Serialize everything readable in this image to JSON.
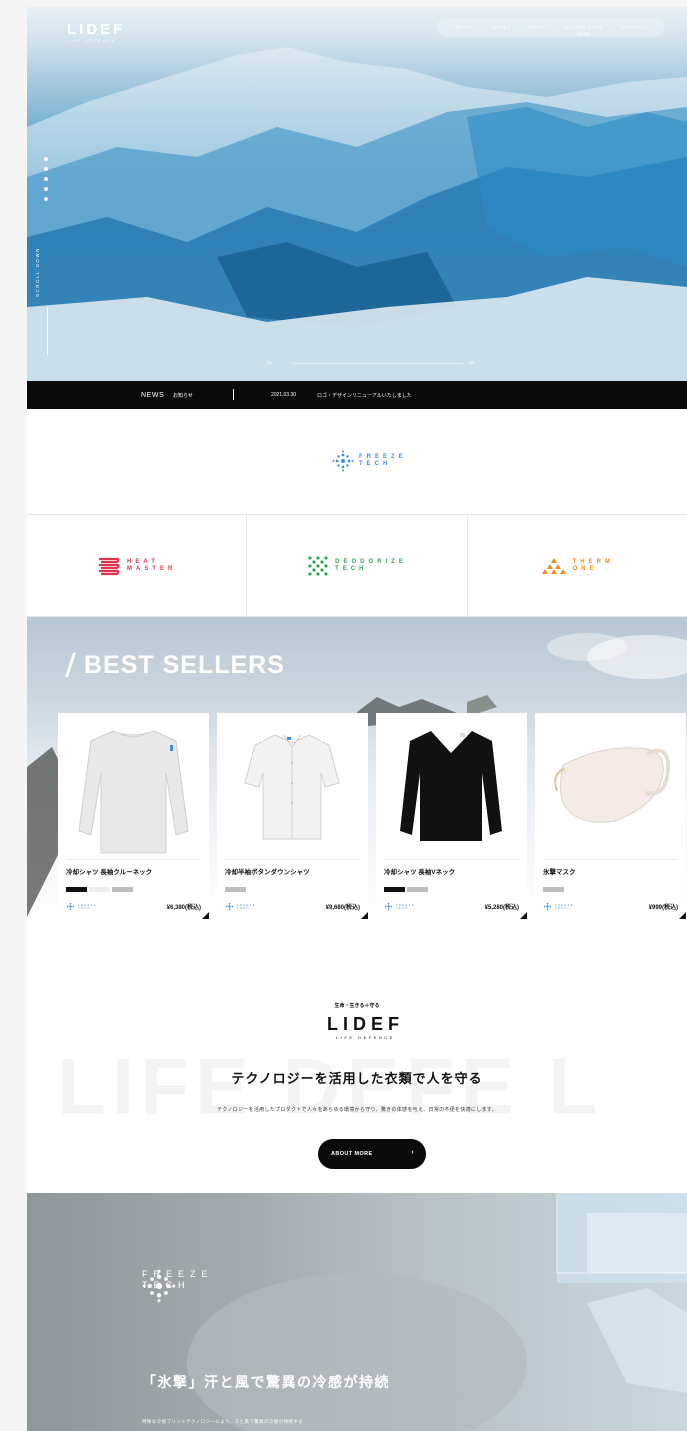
{
  "header": {
    "logo": "LIDEF",
    "logo_sub": "LIFE DEFENCE",
    "nav": [
      "ABOUT",
      "SERIES",
      "NEWS",
      "ONLINE SHOP",
      "CONTACT"
    ],
    "nav_shop_sub": "楽天市場"
  },
  "hero": {
    "scroll_label": "SCROLL DOWN",
    "slide_current": "01",
    "slide_total": "04"
  },
  "news": {
    "label": "NEWS",
    "label_jp": "お知らせ",
    "date": "2021.03.30",
    "text": "ロゴ・デザインリニューアルいたしました"
  },
  "brands": {
    "freeze": [
      "FREEZE",
      "TECH"
    ],
    "heat": [
      "HEAT",
      "MASTER"
    ],
    "deodorize": [
      "DEODORIZE",
      "TECH"
    ],
    "therm": [
      "THERM",
      "ONE"
    ],
    "colors": {
      "freeze": "#3c8fd4",
      "heat": "#e0344e",
      "deodorize": "#2ea55a",
      "therm": "#f08a1c"
    }
  },
  "best": {
    "title": "BEST SELLERS",
    "products": [
      {
        "name": "冷却シャツ 長袖クルーネック",
        "price": "¥6,380(税込)",
        "swatches": [
          "#111111",
          "#eeeeee",
          "#bdbdbd"
        ]
      },
      {
        "name": "冷却半袖ボタンダウンシャツ",
        "price": "¥9,680(税込)",
        "swatches": [
          "#bdbdbd"
        ]
      },
      {
        "name": "冷却シャツ 長袖Vネック",
        "price": "¥5,280(税込)",
        "swatches": [
          "#111111",
          "#bdbdbd"
        ]
      },
      {
        "name": "氷撃マスク",
        "price": "¥999(税込)",
        "swatches": [
          "#bdbdbd"
        ]
      }
    ],
    "card_brand": [
      "FREEZE",
      "TECH"
    ]
  },
  "about": {
    "kicker": "生命・生きる＋守る",
    "logo": "LIDEF",
    "logo_sub": "LIFE DEFENCE",
    "bg_text": "LIFE DEFE L",
    "heading": "テクノロジーを活用した衣類で人を守る",
    "body": "テクノロジーを活用したプロダクトで人々をあらゆる環境から守り、驚きの体感を与え、日常の不便を快適にします。",
    "button": "ABOUT MORE",
    "button_arrow": "›"
  },
  "feature": {
    "brand": [
      "FREEZE",
      "TECH"
    ],
    "heading": "「氷撃」汗と風で驚異の冷感が持続",
    "body": "特殊な冷感プリントテクノロジーにより、汗と風で驚異の冷感が持続する"
  }
}
